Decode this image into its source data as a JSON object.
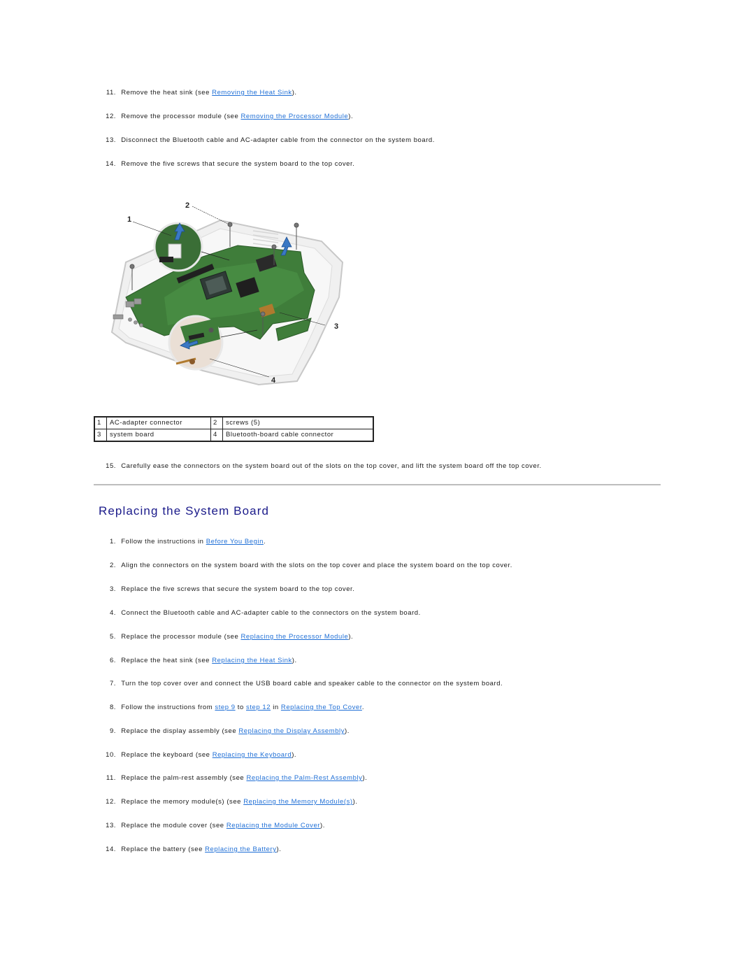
{
  "removal_steps": [
    {
      "num": "11.",
      "pre": "Remove the heat sink (see ",
      "link": "Removing the Heat Sink",
      "post": ")."
    },
    {
      "num": "12.",
      "pre": "Remove the processor module (see ",
      "link": "Removing the Processor Module",
      "post": ")."
    },
    {
      "num": "13.",
      "text": "Disconnect the Bluetooth cable and AC-adapter cable from the connector on the system board."
    },
    {
      "num": "14.",
      "text": "Remove the five screws that secure the system board to the top cover."
    },
    {
      "num": "15.",
      "text": "Carefully ease the connectors on the system board out of the slots on the top cover, and lift the system board off the top cover."
    }
  ],
  "figure": {
    "callouts": [
      "1",
      "2",
      "3",
      "4"
    ]
  },
  "legend": [
    [
      {
        "num": "1",
        "label": "AC-adapter connector"
      },
      {
        "num": "2",
        "label": "screws (5)"
      }
    ],
    [
      {
        "num": "3",
        "label": "system board"
      },
      {
        "num": "4",
        "label": "Bluetooth-board cable connector"
      }
    ]
  ],
  "section_title": "Replacing the System Board",
  "replace_steps": [
    {
      "num": "1.",
      "pre": "Follow the instructions in ",
      "link": "Before You Begin",
      "post": "."
    },
    {
      "num": "2.",
      "text": "Align the connectors on the system board with the slots on the top cover and place the system board on the top cover."
    },
    {
      "num": "3.",
      "text": "Replace the five screws that secure the system board to the top cover."
    },
    {
      "num": "4.",
      "text": "Connect the Bluetooth cable and AC-adapter cable to the connectors on the system board."
    },
    {
      "num": "5.",
      "pre": "Replace the processor module (see ",
      "link": "Replacing the Processor Module",
      "post": ")."
    },
    {
      "num": "6.",
      "pre": "Replace the heat sink (see ",
      "link": "Replacing the Heat Sink",
      "post": ")."
    },
    {
      "num": "7.",
      "text": "Turn the top cover over and connect the USB board cable and speaker cable to the connector on the system board."
    },
    {
      "num": "8.",
      "pre": "Follow the instructions from ",
      "link": "step 9",
      "mid1": " to ",
      "link2": "step 12",
      "mid2": " in ",
      "link3": "Replacing the Top Cover",
      "post": "."
    },
    {
      "num": "9.",
      "pre": "Replace the display assembly (see ",
      "link": "Replacing the Display Assembly",
      "post": ")."
    },
    {
      "num": "10.",
      "pre": "Replace the keyboard (see ",
      "link": "Replacing the Keyboard",
      "post": ")."
    },
    {
      "num": "11.",
      "pre": "Replace the palm-rest assembly (see ",
      "link": "Replacing the Palm-Rest Assembly",
      "post": ")."
    },
    {
      "num": "12.",
      "pre": "Replace the memory module(s) (see ",
      "link": "Replacing the Memory Module(s)",
      "post": ")."
    },
    {
      "num": "13.",
      "pre": "Replace the module cover (see ",
      "link": "Replacing the Module Cover",
      "post": ")."
    },
    {
      "num": "14.",
      "pre": "Replace the battery (see ",
      "link": "Replacing the Battery",
      "post": ")."
    }
  ],
  "colors": {
    "link": "#1f6fd6",
    "heading": "#1a1a8a",
    "text": "#1a1a1a",
    "board_green": "#3f7d3a"
  }
}
